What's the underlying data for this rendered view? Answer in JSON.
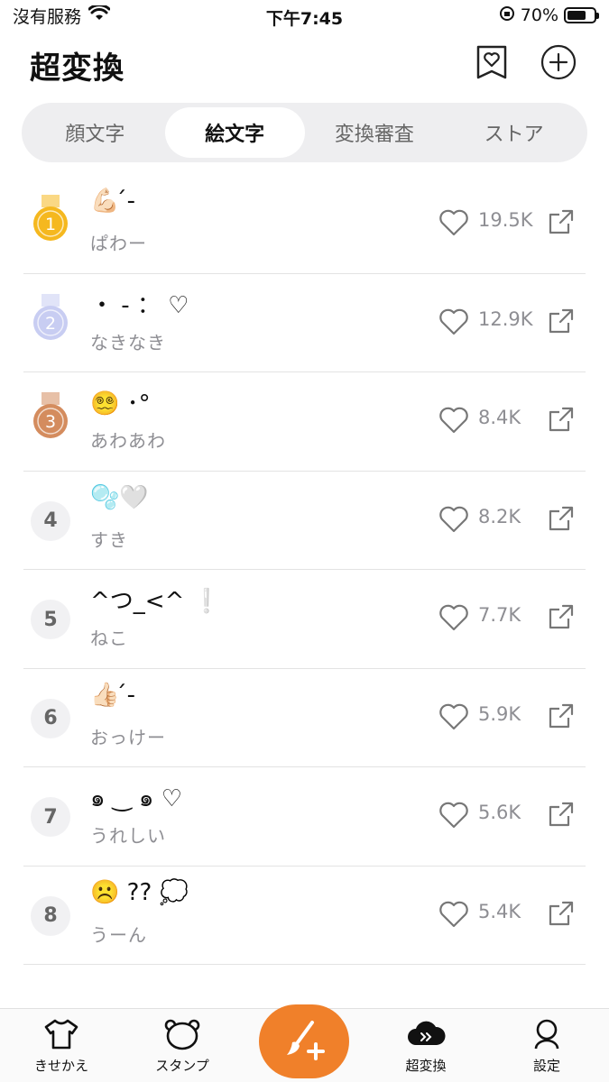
{
  "status_bar": {
    "carrier": "沒有服務",
    "time": "下午7:45",
    "battery_percent": "70%",
    "battery_level": 0.7
  },
  "header": {
    "title": "超変換",
    "favorites_icon": "heart-bookmark-icon",
    "add_icon": "plus-circle-icon"
  },
  "tabs": [
    {
      "label": "顔文字",
      "active": false
    },
    {
      "label": "絵文字",
      "active": true
    },
    {
      "label": "変換審査",
      "active": false
    },
    {
      "label": "ストア",
      "active": false
    }
  ],
  "items": [
    {
      "rank": "1",
      "medal": "gold",
      "emoji": "💪🏻 ́-",
      "reading": "ぱわー",
      "likes": "19.5K"
    },
    {
      "rank": "2",
      "medal": "silver",
      "emoji": "・ - ： ♡",
      "reading": "なきなき",
      "likes": "12.9K"
    },
    {
      "rank": "3",
      "medal": "bronze",
      "emoji": "😵‍💫 ･°",
      "reading": "あわあわ",
      "likes": "8.4K"
    },
    {
      "rank": "4",
      "medal": "",
      "emoji": "🫧🤍",
      "reading": "すき",
      "likes": "8.2K"
    },
    {
      "rank": "5",
      "medal": "",
      "emoji": "^つ_<^ ❕",
      "reading": "ねこ",
      "likes": "7.7K"
    },
    {
      "rank": "6",
      "medal": "",
      "emoji": "👍🏻 ́-",
      "reading": "おっけー",
      "likes": "5.9K"
    },
    {
      "rank": "7",
      "medal": "",
      "emoji": "๑ ‿ ๑ ♡",
      "reading": "うれしい",
      "likes": "5.6K"
    },
    {
      "rank": "8",
      "medal": "",
      "emoji": "☹️ ?? 💭",
      "reading": "うーん",
      "likes": "5.4K"
    }
  ],
  "tabbar": {
    "items": [
      {
        "label": "きせかえ",
        "icon": "shirt-icon"
      },
      {
        "label": "スタンプ",
        "icon": "bear-face-icon"
      },
      {
        "label": "超変換",
        "icon": "cloud-forward-icon"
      },
      {
        "label": "設定",
        "icon": "person-icon"
      }
    ],
    "fab_icon": "brush-plus-icon"
  },
  "colors": {
    "accent": "#f0802a",
    "gold": "#f5b81f",
    "silver": "#c8cdf2",
    "bronze": "#d48c5e",
    "muted_text": "#8e8e93"
  }
}
